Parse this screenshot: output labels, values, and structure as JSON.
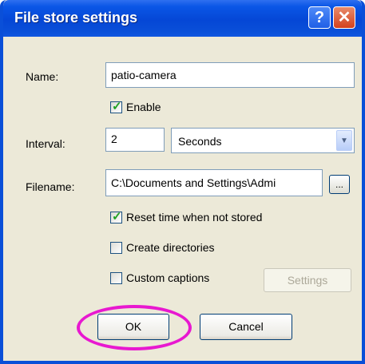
{
  "window": {
    "title": "File store settings",
    "help_glyph": "?",
    "close_glyph": "✕"
  },
  "form": {
    "name_label": "Name:",
    "name_value": "patio-camera",
    "enable_label": "Enable",
    "enable_checked": true,
    "interval_label": "Interval:",
    "interval_value": "2",
    "interval_unit": "Seconds",
    "filename_label": "Filename:",
    "filename_value": "C:\\Documents and Settings\\Admi",
    "browse_label": "...",
    "reset_time_label": "Reset time when not stored",
    "reset_time_checked": true,
    "create_dirs_label": "Create directories",
    "create_dirs_checked": false,
    "custom_captions_label": "Custom captions",
    "custom_captions_checked": false,
    "settings_button": "Settings"
  },
  "buttons": {
    "ok": "OK",
    "cancel": "Cancel"
  },
  "colors": {
    "title_bar": "#0a4fd8",
    "highlight_ring": "#e818d0",
    "checkmark": "#21a121"
  }
}
